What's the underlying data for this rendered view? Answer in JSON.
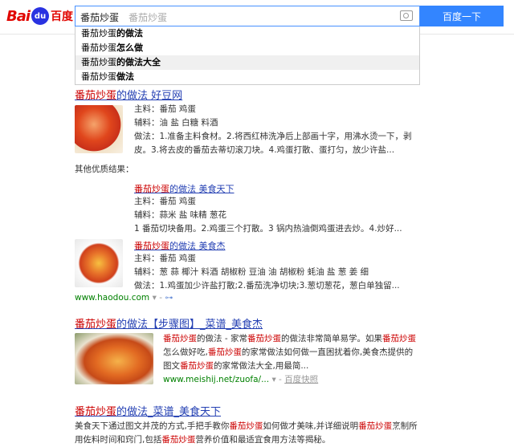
{
  "header": {
    "logo_bai": "Bai",
    "logo_paw": "du",
    "logo_du": "百度",
    "query": "番茄炒蛋",
    "placeholder": "番茄炒蛋",
    "search_button": "百度一下"
  },
  "suggestions": [
    {
      "prefix": "番茄炒蛋",
      "suffix": "的做法"
    },
    {
      "prefix": "番茄炒蛋",
      "suffix": "怎么做"
    },
    {
      "prefix": "番茄炒蛋",
      "suffix": "的做法大全"
    },
    {
      "prefix": "番茄炒蛋",
      "suffix": "做法"
    }
  ],
  "r1": {
    "title_em": "番茄炒蛋",
    "title_rest": "的做法  好豆网",
    "main": "主料：番茄 鸡蛋",
    "aux": "辅料：油 盐 白糖 料酒",
    "step1": "做法：1.准备主料食材。2.将西红柿洗净后上部画十字，用沸水烫一下，剥",
    "step2": "皮。3.将去皮的番茄去蒂切滚刀块。4.鸡蛋打散、蛋打匀，放少许盐..."
  },
  "other_label": "其他优质结果：",
  "r1a": {
    "title_em": "番茄炒蛋",
    "title_rest": "的做法  美食天下",
    "main": "主料：番茄 鸡蛋",
    "aux": "辅料：蒜米 盐 味精 葱花",
    "steps": "1 番茄切块备用。2.鸡蛋三个打散。3 锅内热油倒鸡蛋进去炒。4.炒好..."
  },
  "r1b": {
    "title_em": "番茄炒蛋",
    "title_rest": "的做法  美食杰",
    "main": "主料：番茄 鸡蛋",
    "aux": "辅料：葱 蒜 椰汁 料酒 胡椒粉 豆油 油 胡椒粉 蚝油 盐 葱 姜 细",
    "steps": "做法：1.鸡蛋加少许盐打散;2.番茄洗净切块;3.葱切葱花，葱白单独留..."
  },
  "r1_url": "www.haodou.com",
  "r2": {
    "title_em": "番茄炒蛋",
    "title_rest": "的做法【步骤图】_菜谱_美食杰",
    "l1_em": "番茄炒蛋",
    "l1_mid": "的做法 - 家常",
    "l1_em2": "番茄炒蛋",
    "l1_tail": "的做法非常简单易学。如果",
    "l1_em3": "番茄炒蛋",
    "l2_a": "怎么做好吃,",
    "l2_em": "番茄炒蛋",
    "l2_b": "的家常做法如何做一直困扰着你,美食杰提供的",
    "l3_a": "图文",
    "l3_em": "番茄炒蛋",
    "l3_b": "的家常做法大全,用最简...",
    "url": "www.meishij.net/zuofa/...",
    "snapshot": "百度快照"
  },
  "r3": {
    "title_em": "番茄炒蛋",
    "title_rest": "的做法_菜谱_美食天下",
    "l1_a": "美食天下通过图文并茂的方式,手把手教你",
    "l1_em": "番茄炒蛋",
    "l1_b": "如何做才美味,并详细说明",
    "l1_em2": "番茄炒蛋",
    "l1_c": "烹制所",
    "l2_a": "用佐料时间和窍门,包括",
    "l2_em": "番茄炒蛋",
    "l2_b": "营养价值和最适宜食用方法等揭秘。"
  }
}
